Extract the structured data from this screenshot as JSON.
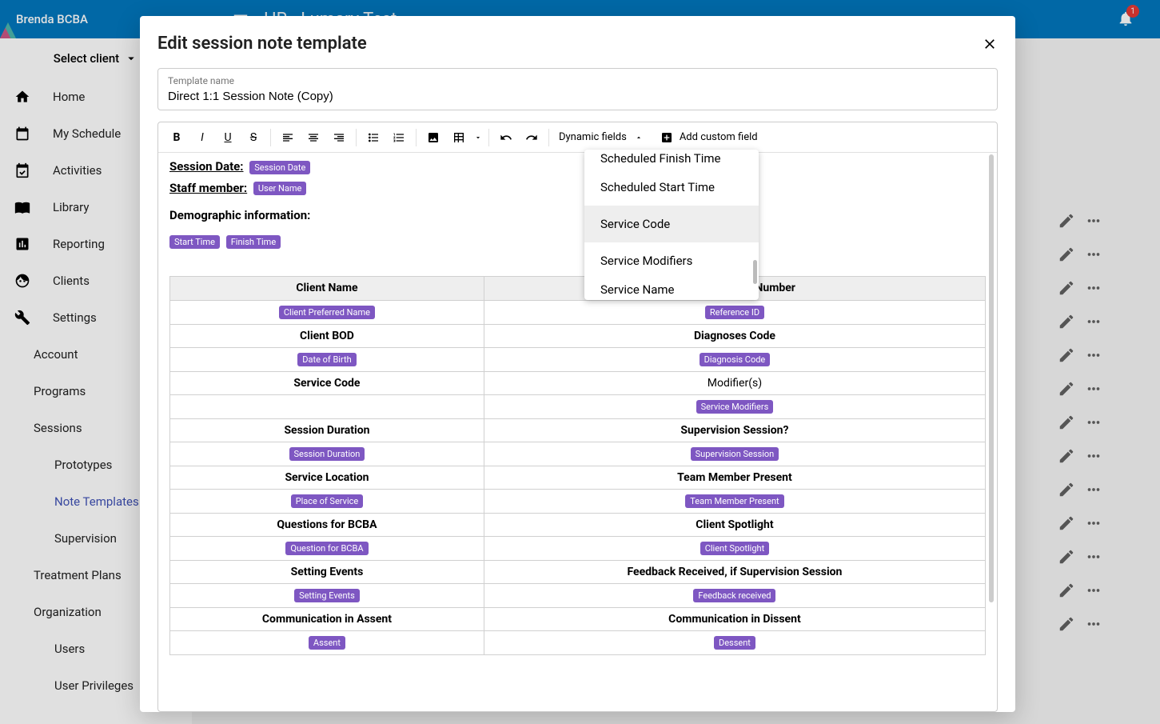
{
  "header": {
    "user_name": "Brenda BCBA",
    "app_title": "HR - Lumary Test",
    "notification_count": "1"
  },
  "sidebar": {
    "client_selector": "Select client",
    "items": [
      {
        "label": "Home"
      },
      {
        "label": "My Schedule"
      },
      {
        "label": "Activities"
      },
      {
        "label": "Library"
      },
      {
        "label": "Reporting"
      },
      {
        "label": "Clients"
      },
      {
        "label": "Settings"
      }
    ],
    "settings_sub": [
      {
        "label": "Account"
      },
      {
        "label": "Programs"
      },
      {
        "label": "Sessions"
      }
    ],
    "sessions_sub": [
      {
        "label": "Prototypes"
      },
      {
        "label": "Note Templates",
        "active": true
      },
      {
        "label": "Supervision"
      }
    ],
    "settings_sub2": [
      {
        "label": "Treatment Plans"
      },
      {
        "label": "Organization"
      }
    ],
    "org_sub": [
      {
        "label": "Users"
      },
      {
        "label": "User Privileges"
      }
    ]
  },
  "modal": {
    "title": "Edit session note template",
    "template_name_label": "Template name",
    "template_name_value": "Direct 1:1 Session Note (Copy)",
    "toolbar": {
      "dynamic_fields": "Dynamic fields",
      "add_custom": "Add custom field"
    },
    "body": {
      "session_date_label": "Session Date:",
      "session_date_chip": "Session Date",
      "staff_label": "Staff member:",
      "staff_chip": "User Name",
      "demo_label": "Demographic information:",
      "start_chip": "Start Time",
      "finish_chip": "Finish Time"
    },
    "table": {
      "headers": [
        "Client Name",
        "Medical Record Number"
      ],
      "rows": [
        {
          "l_chip": "Client Preferred Name",
          "r_chip": "Reference ID"
        },
        {
          "l_label": "Client BOD",
          "r_label": "Diagnoses Code"
        },
        {
          "l_chip": "Date of Birth",
          "r_chip": "Diagnosis Code"
        },
        {
          "l_label": "Service Code",
          "r_plain": "Modifier(s)"
        },
        {
          "l_chip": "",
          "r_chip": "Service Modifiers"
        },
        {
          "l_label": "Session Duration",
          "r_label": "Supervision Session?"
        },
        {
          "l_chip": "Session Duration",
          "r_chip": "Supervision Session"
        },
        {
          "l_label": "Service Location",
          "r_label": "Team Member Present"
        },
        {
          "l_chip": "Place of Service",
          "r_chip": "Team Member Present"
        },
        {
          "l_label": "Questions for BCBA",
          "r_label": "Client Spotlight"
        },
        {
          "l_chip": "Question for BCBA",
          "r_chip": "Client Spotlight"
        },
        {
          "l_label": "Setting Events",
          "r_label": "Feedback Received, if Supervision Session"
        },
        {
          "l_chip": "Setting Events",
          "r_chip": "Feedback received"
        },
        {
          "l_label": "Communication in Assent",
          "r_label": "Communication in Dissent"
        },
        {
          "l_chip": "Assent",
          "r_chip": "Dessent"
        }
      ]
    }
  },
  "dropdown": {
    "items": [
      {
        "label": "Scheduled Finish Time",
        "clipped": "top"
      },
      {
        "label": "Scheduled Start Time"
      },
      {
        "label": "Service Code",
        "highlight": true
      },
      {
        "label": "Service Modifiers"
      },
      {
        "label": "Service Name",
        "clipped": "bot"
      }
    ]
  }
}
